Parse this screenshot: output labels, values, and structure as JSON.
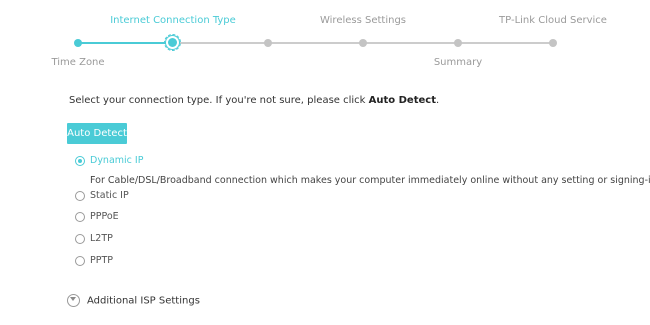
{
  "stepper": {
    "steps": [
      {
        "label": "Time Zone",
        "state": "done"
      },
      {
        "label": "Internet Connection Type",
        "state": "current"
      },
      {
        "label": "",
        "state": "pending"
      },
      {
        "label": "Wireless Settings",
        "state": "pending"
      },
      {
        "label": "Summary",
        "state": "pending"
      },
      {
        "label": "TP-Link Cloud Service",
        "state": "pending"
      }
    ]
  },
  "instruction": {
    "text": "Select your connection type. If you're not sure, please click ",
    "bold": "Auto Detect",
    "suffix": "."
  },
  "auto_detect_label": "Auto Detect",
  "connection_types": [
    {
      "label": "Dynamic IP",
      "checked": true,
      "description": "For Cable/DSL/Broadband connection which makes your computer immediately online without any setting or signing-in."
    },
    {
      "label": "Static IP",
      "checked": false
    },
    {
      "label": "PPPoE",
      "checked": false
    },
    {
      "label": "L2TP",
      "checked": false
    },
    {
      "label": "PPTP",
      "checked": false
    }
  ],
  "additional_settings_label": "Additional ISP Settings",
  "colors": {
    "accent": "#4acbd6",
    "inactive": "#c4c4c4"
  },
  "icons": {
    "radio": "radio-button",
    "expand": "circle-chevron-down-icon"
  }
}
